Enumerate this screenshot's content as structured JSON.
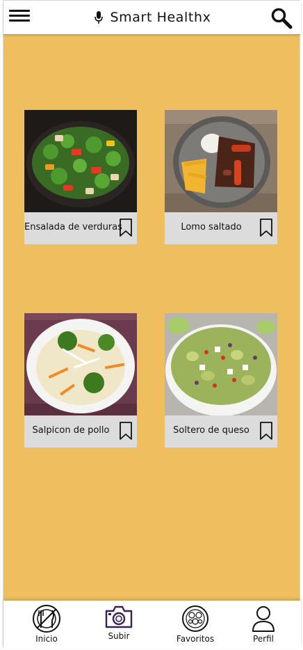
{
  "header": {
    "title": "Smart Healthx",
    "menu_icon": "hamburger-menu-icon",
    "mic_icon": "microphone-icon",
    "search_icon": "search-icon"
  },
  "recipes": [
    {
      "label": "Ensalada de verduras",
      "image": "stir-fried-vegetables-photo"
    },
    {
      "label": "Lomo saltado",
      "image": "lomo-saltado-photo"
    },
    {
      "label": "Salpicon de pollo",
      "image": "chicken-salad-photo"
    },
    {
      "label": "Soltero de queso",
      "image": "bean-cheese-salad-photo"
    }
  ],
  "bottom_nav": [
    {
      "label": "Inicio",
      "icon": "plate-utensils-icon"
    },
    {
      "label": "Subir",
      "icon": "camera-icon"
    },
    {
      "label": "Favoritos",
      "icon": "food-plate-icon"
    },
    {
      "label": "Perfil",
      "icon": "user-icon"
    }
  ],
  "colors": {
    "background": "#efbf5f",
    "card": "#dcdcdc",
    "camera_icon": "#3b1f4e"
  }
}
